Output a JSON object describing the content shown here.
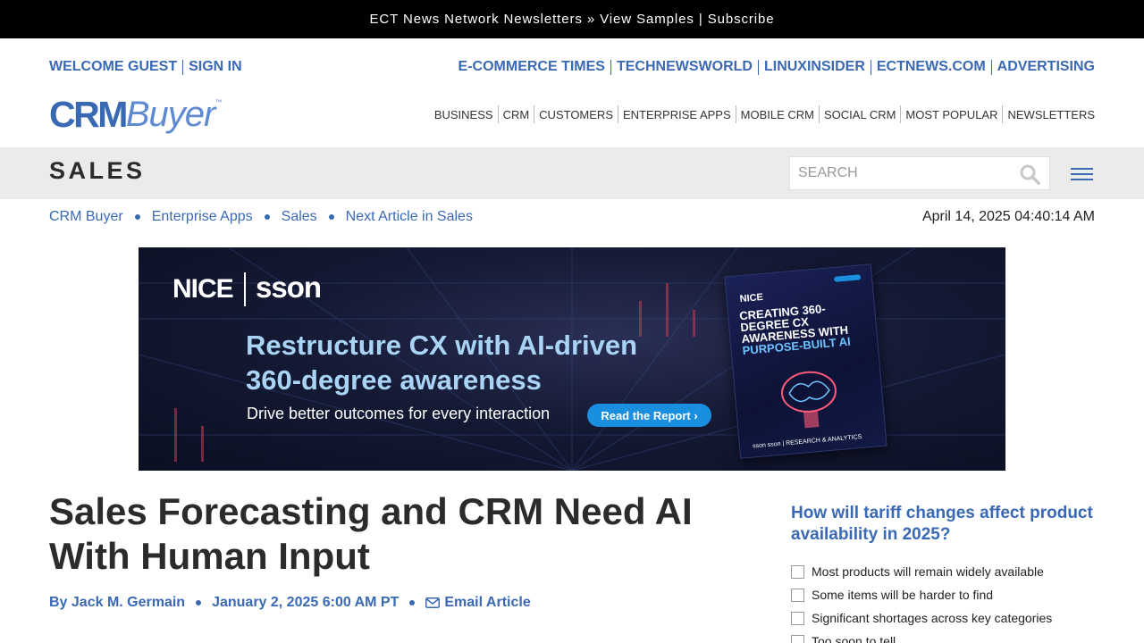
{
  "topbar": {
    "prefix": "ECT News Network Newsletters » ",
    "view_samples": "View Samples",
    "pipe": " | ",
    "subscribe": "Subscribe"
  },
  "header": {
    "welcome": "WELCOME GUEST",
    "sign_in": "SIGN IN",
    "network_links": [
      "E-COMMERCE TIMES",
      "TECHNEWSWORLD",
      "LINUXINSIDER",
      "ECTNEWS.COM",
      "ADVERTISING"
    ],
    "logo": {
      "part1": "CRM",
      "part2": "Buyer",
      "tm": "™"
    },
    "nav": [
      "BUSINESS",
      "CRM",
      "CUSTOMERS",
      "ENTERPRISE APPS",
      "MOBILE CRM",
      "SOCIAL CRM",
      "MOST POPULAR",
      "NEWSLETTERS"
    ]
  },
  "section": {
    "title": "SALES",
    "search_placeholder": "SEARCH",
    "search_icon": "search-icon",
    "menu_icon": "hamburger-menu-icon"
  },
  "breadcrumb": {
    "items": [
      "CRM Buyer",
      "Enterprise Apps",
      "Sales",
      "Next Article in Sales"
    ],
    "datetime": "April 14, 2025 04:40:14 AM"
  },
  "banner": {
    "brand1": "NICE",
    "brand2": "sson",
    "headline_line1": "Restructure CX with AI-driven",
    "headline_line2": "360-degree awareness",
    "subtext": "Drive better outcomes for every interaction",
    "cta": "Read the Report ›",
    "book_brand": "NICE",
    "book_title": "CREATING 360-DEGREE CX AWARENESS WITH",
    "book_title_accent": "PURPOSE-BUILT AI",
    "book_footer": "sson  sson | RESEARCH & ANALYTICS",
    "colors": {
      "headline": "#a9d4f5",
      "cta": "#1a8fe0",
      "background": "#151a35"
    }
  },
  "article": {
    "title": "Sales Forecasting and CRM Need AI With Human Input",
    "author": "By Jack M. Germain",
    "date": "January 2, 2025 6:00 AM PT",
    "email_label": "Email Article",
    "email_icon": "mail-icon"
  },
  "poll": {
    "question": "How will tariff changes affect product availability in 2025?",
    "options": [
      "Most products will remain widely available",
      "Some items will be harder to find",
      "Significant shortages across key categories",
      "Too soon to tell"
    ]
  },
  "colors": {
    "brand_blue": "#3a69b4",
    "section_bar": "#ebebeb",
    "topbar": "#000000"
  }
}
